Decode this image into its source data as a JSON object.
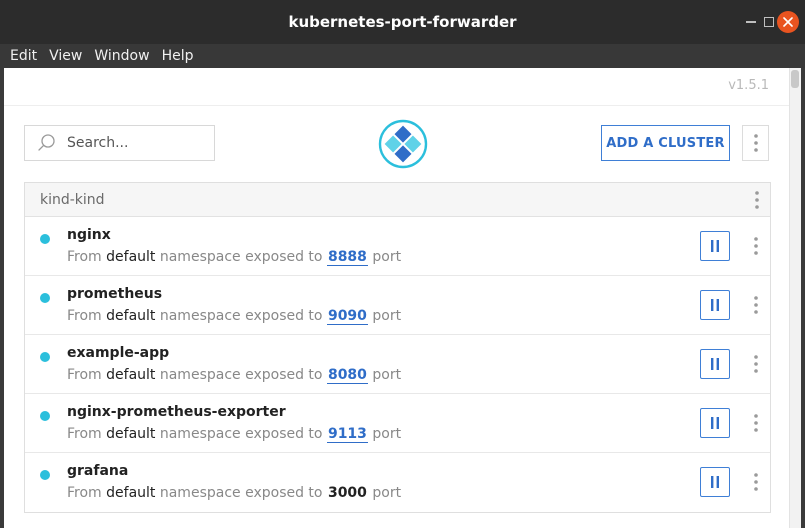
{
  "window": {
    "title": "kubernetes-port-forwarder"
  },
  "menu": [
    "Edit",
    "View",
    "Window",
    "Help"
  ],
  "app": {
    "version": "v1.5.1",
    "search": {
      "placeholder": "Search...",
      "value": ""
    },
    "add_cluster_label": "ADD A CLUSTER",
    "colors": {
      "accent": "#2f6dc8",
      "status_dot": "#2bbfdc",
      "close_button": "#e95420"
    }
  },
  "cluster": {
    "name": "kind-kind",
    "services": [
      {
        "name": "nginx",
        "prefix": "From",
        "namespace": "default",
        "middle": "namespace exposed to",
        "port": "8888",
        "port_style": "link",
        "suffix": "port"
      },
      {
        "name": "prometheus",
        "prefix": "From",
        "namespace": "default",
        "middle": "namespace exposed to",
        "port": "9090",
        "port_style": "link",
        "suffix": "port"
      },
      {
        "name": "example-app",
        "prefix": "From",
        "namespace": "default",
        "middle": "namespace exposed to",
        "port": "8080",
        "port_style": "link",
        "suffix": "port"
      },
      {
        "name": "nginx-prometheus-exporter",
        "prefix": "From",
        "namespace": "default",
        "middle": "namespace exposed to",
        "port": "9113",
        "port_style": "link",
        "suffix": "port"
      },
      {
        "name": "grafana",
        "prefix": "From",
        "namespace": "default",
        "middle": "namespace exposed to",
        "port": "3000",
        "port_style": "plain",
        "suffix": "port"
      }
    ]
  },
  "icons": {
    "search": "search-icon",
    "logo": "app-logo",
    "kebab": "kebab-menu-icon",
    "pause": "pause-icon",
    "close": "close-icon",
    "minimize": "minimize-icon",
    "maximize": "maximize-icon"
  }
}
